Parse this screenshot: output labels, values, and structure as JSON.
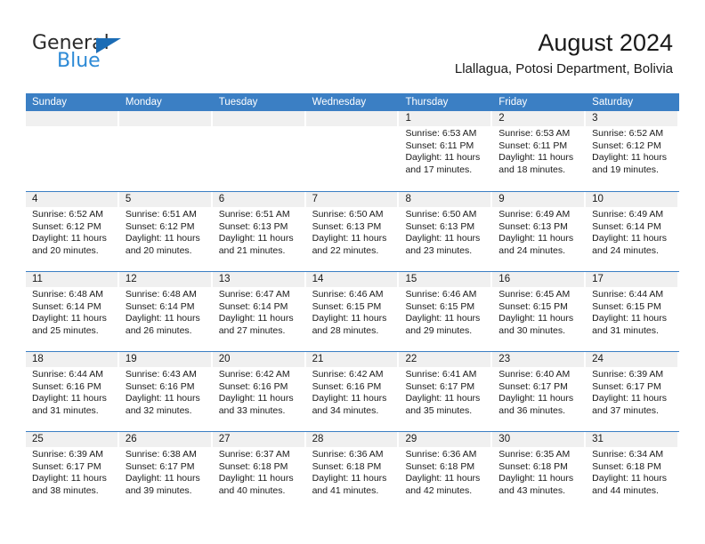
{
  "logo": {
    "word_one": "General",
    "word_two": "Blue",
    "triangle_color": "#1b6cb5",
    "blue_color": "#2d8ad6"
  },
  "header": {
    "title": "August 2024",
    "subtitle": "Llallagua, Potosi Department, Bolivia"
  },
  "colors": {
    "header_blue": "#3b7fc4",
    "day_band_gray": "#f0f0f0",
    "text": "#1a1a1a"
  },
  "weekdays": [
    "Sunday",
    "Monday",
    "Tuesday",
    "Wednesday",
    "Thursday",
    "Friday",
    "Saturday"
  ],
  "weeks": [
    [
      {
        "day": "",
        "empty": true
      },
      {
        "day": "",
        "empty": true
      },
      {
        "day": "",
        "empty": true
      },
      {
        "day": "",
        "empty": true
      },
      {
        "day": "1",
        "sunrise": "Sunrise: 6:53 AM",
        "sunset": "Sunset: 6:11 PM",
        "daylight_1": "Daylight: 11 hours",
        "daylight_2": "and 17 minutes."
      },
      {
        "day": "2",
        "sunrise": "Sunrise: 6:53 AM",
        "sunset": "Sunset: 6:11 PM",
        "daylight_1": "Daylight: 11 hours",
        "daylight_2": "and 18 minutes."
      },
      {
        "day": "3",
        "sunrise": "Sunrise: 6:52 AM",
        "sunset": "Sunset: 6:12 PM",
        "daylight_1": "Daylight: 11 hours",
        "daylight_2": "and 19 minutes."
      }
    ],
    [
      {
        "day": "4",
        "sunrise": "Sunrise: 6:52 AM",
        "sunset": "Sunset: 6:12 PM",
        "daylight_1": "Daylight: 11 hours",
        "daylight_2": "and 20 minutes."
      },
      {
        "day": "5",
        "sunrise": "Sunrise: 6:51 AM",
        "sunset": "Sunset: 6:12 PM",
        "daylight_1": "Daylight: 11 hours",
        "daylight_2": "and 20 minutes."
      },
      {
        "day": "6",
        "sunrise": "Sunrise: 6:51 AM",
        "sunset": "Sunset: 6:13 PM",
        "daylight_1": "Daylight: 11 hours",
        "daylight_2": "and 21 minutes."
      },
      {
        "day": "7",
        "sunrise": "Sunrise: 6:50 AM",
        "sunset": "Sunset: 6:13 PM",
        "daylight_1": "Daylight: 11 hours",
        "daylight_2": "and 22 minutes."
      },
      {
        "day": "8",
        "sunrise": "Sunrise: 6:50 AM",
        "sunset": "Sunset: 6:13 PM",
        "daylight_1": "Daylight: 11 hours",
        "daylight_2": "and 23 minutes."
      },
      {
        "day": "9",
        "sunrise": "Sunrise: 6:49 AM",
        "sunset": "Sunset: 6:13 PM",
        "daylight_1": "Daylight: 11 hours",
        "daylight_2": "and 24 minutes."
      },
      {
        "day": "10",
        "sunrise": "Sunrise: 6:49 AM",
        "sunset": "Sunset: 6:14 PM",
        "daylight_1": "Daylight: 11 hours",
        "daylight_2": "and 24 minutes."
      }
    ],
    [
      {
        "day": "11",
        "sunrise": "Sunrise: 6:48 AM",
        "sunset": "Sunset: 6:14 PM",
        "daylight_1": "Daylight: 11 hours",
        "daylight_2": "and 25 minutes."
      },
      {
        "day": "12",
        "sunrise": "Sunrise: 6:48 AM",
        "sunset": "Sunset: 6:14 PM",
        "daylight_1": "Daylight: 11 hours",
        "daylight_2": "and 26 minutes."
      },
      {
        "day": "13",
        "sunrise": "Sunrise: 6:47 AM",
        "sunset": "Sunset: 6:14 PM",
        "daylight_1": "Daylight: 11 hours",
        "daylight_2": "and 27 minutes."
      },
      {
        "day": "14",
        "sunrise": "Sunrise: 6:46 AM",
        "sunset": "Sunset: 6:15 PM",
        "daylight_1": "Daylight: 11 hours",
        "daylight_2": "and 28 minutes."
      },
      {
        "day": "15",
        "sunrise": "Sunrise: 6:46 AM",
        "sunset": "Sunset: 6:15 PM",
        "daylight_1": "Daylight: 11 hours",
        "daylight_2": "and 29 minutes."
      },
      {
        "day": "16",
        "sunrise": "Sunrise: 6:45 AM",
        "sunset": "Sunset: 6:15 PM",
        "daylight_1": "Daylight: 11 hours",
        "daylight_2": "and 30 minutes."
      },
      {
        "day": "17",
        "sunrise": "Sunrise: 6:44 AM",
        "sunset": "Sunset: 6:15 PM",
        "daylight_1": "Daylight: 11 hours",
        "daylight_2": "and 31 minutes."
      }
    ],
    [
      {
        "day": "18",
        "sunrise": "Sunrise: 6:44 AM",
        "sunset": "Sunset: 6:16 PM",
        "daylight_1": "Daylight: 11 hours",
        "daylight_2": "and 31 minutes."
      },
      {
        "day": "19",
        "sunrise": "Sunrise: 6:43 AM",
        "sunset": "Sunset: 6:16 PM",
        "daylight_1": "Daylight: 11 hours",
        "daylight_2": "and 32 minutes."
      },
      {
        "day": "20",
        "sunrise": "Sunrise: 6:42 AM",
        "sunset": "Sunset: 6:16 PM",
        "daylight_1": "Daylight: 11 hours",
        "daylight_2": "and 33 minutes."
      },
      {
        "day": "21",
        "sunrise": "Sunrise: 6:42 AM",
        "sunset": "Sunset: 6:16 PM",
        "daylight_1": "Daylight: 11 hours",
        "daylight_2": "and 34 minutes."
      },
      {
        "day": "22",
        "sunrise": "Sunrise: 6:41 AM",
        "sunset": "Sunset: 6:17 PM",
        "daylight_1": "Daylight: 11 hours",
        "daylight_2": "and 35 minutes."
      },
      {
        "day": "23",
        "sunrise": "Sunrise: 6:40 AM",
        "sunset": "Sunset: 6:17 PM",
        "daylight_1": "Daylight: 11 hours",
        "daylight_2": "and 36 minutes."
      },
      {
        "day": "24",
        "sunrise": "Sunrise: 6:39 AM",
        "sunset": "Sunset: 6:17 PM",
        "daylight_1": "Daylight: 11 hours",
        "daylight_2": "and 37 minutes."
      }
    ],
    [
      {
        "day": "25",
        "sunrise": "Sunrise: 6:39 AM",
        "sunset": "Sunset: 6:17 PM",
        "daylight_1": "Daylight: 11 hours",
        "daylight_2": "and 38 minutes."
      },
      {
        "day": "26",
        "sunrise": "Sunrise: 6:38 AM",
        "sunset": "Sunset: 6:17 PM",
        "daylight_1": "Daylight: 11 hours",
        "daylight_2": "and 39 minutes."
      },
      {
        "day": "27",
        "sunrise": "Sunrise: 6:37 AM",
        "sunset": "Sunset: 6:18 PM",
        "daylight_1": "Daylight: 11 hours",
        "daylight_2": "and 40 minutes."
      },
      {
        "day": "28",
        "sunrise": "Sunrise: 6:36 AM",
        "sunset": "Sunset: 6:18 PM",
        "daylight_1": "Daylight: 11 hours",
        "daylight_2": "and 41 minutes."
      },
      {
        "day": "29",
        "sunrise": "Sunrise: 6:36 AM",
        "sunset": "Sunset: 6:18 PM",
        "daylight_1": "Daylight: 11 hours",
        "daylight_2": "and 42 minutes."
      },
      {
        "day": "30",
        "sunrise": "Sunrise: 6:35 AM",
        "sunset": "Sunset: 6:18 PM",
        "daylight_1": "Daylight: 11 hours",
        "daylight_2": "and 43 minutes."
      },
      {
        "day": "31",
        "sunrise": "Sunrise: 6:34 AM",
        "sunset": "Sunset: 6:18 PM",
        "daylight_1": "Daylight: 11 hours",
        "daylight_2": "and 44 minutes."
      }
    ]
  ]
}
